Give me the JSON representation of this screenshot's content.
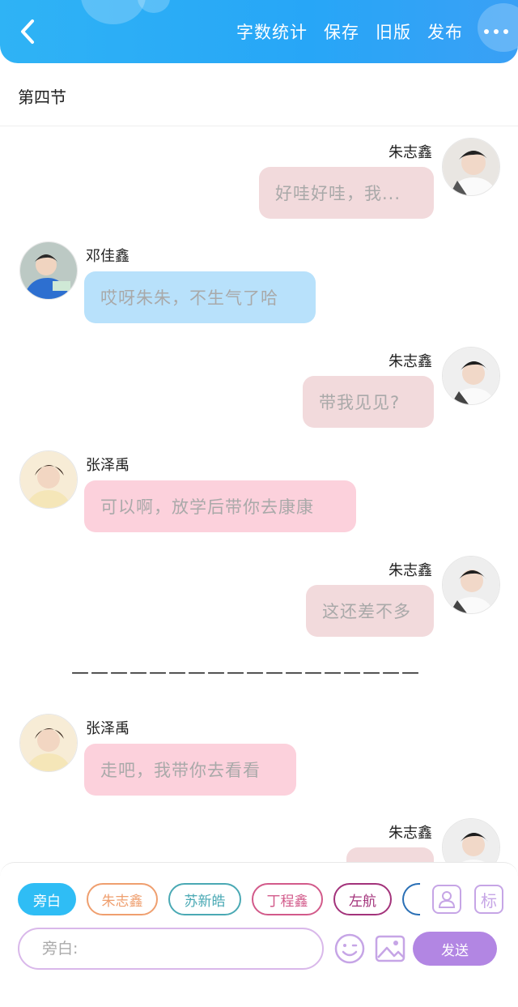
{
  "header": {
    "actions": [
      "字数统计",
      "保存",
      "旧版",
      "发布"
    ],
    "more_icon": "more-dots-icon",
    "back_icon": "chevron-left-icon",
    "bg_color": "#2fb3f5"
  },
  "section": {
    "title": "第四节"
  },
  "messages": [
    {
      "side": "right",
      "name": "朱志鑫",
      "text": "好哇好哇，我...",
      "color": "#f2dadc"
    },
    {
      "side": "left",
      "name": "邓佳鑫",
      "text": "哎呀朱朱，不生气了哈",
      "color": "#b8e1fb"
    },
    {
      "side": "right",
      "name": "朱志鑫",
      "text": "带我见见?",
      "color": "#f2dadc"
    },
    {
      "side": "left",
      "name": "张泽禹",
      "text": "可以啊，放学后带你去康康",
      "color": "#fcd1dc"
    },
    {
      "side": "right",
      "name": "朱志鑫",
      "text": "这还差不多",
      "color": "#f2dadc"
    },
    {
      "side": "left",
      "name": "张泽禹",
      "text": "走吧，我带你去看看",
      "color": "#fcd1dc"
    },
    {
      "side": "right",
      "name": "朱志鑫",
      "text": "",
      "color": "#f2dadc"
    }
  ],
  "separator": "——————————————————",
  "composer": {
    "roles": [
      {
        "label": "旁白",
        "active": true,
        "color": "#2fbdf5"
      },
      {
        "label": "朱志鑫",
        "active": false,
        "color": "#ef9f6f"
      },
      {
        "label": "苏新皓",
        "active": false,
        "color": "#4aa9b4"
      },
      {
        "label": "丁程鑫",
        "active": false,
        "color": "#d25a8a"
      },
      {
        "label": "左航",
        "active": false,
        "color": "#a3337b"
      }
    ],
    "role_icon": "person-card-icon",
    "tag_icon_label": "标",
    "input_placeholder": "旁白:",
    "send_label": "发送",
    "accent": "#b286e3"
  }
}
